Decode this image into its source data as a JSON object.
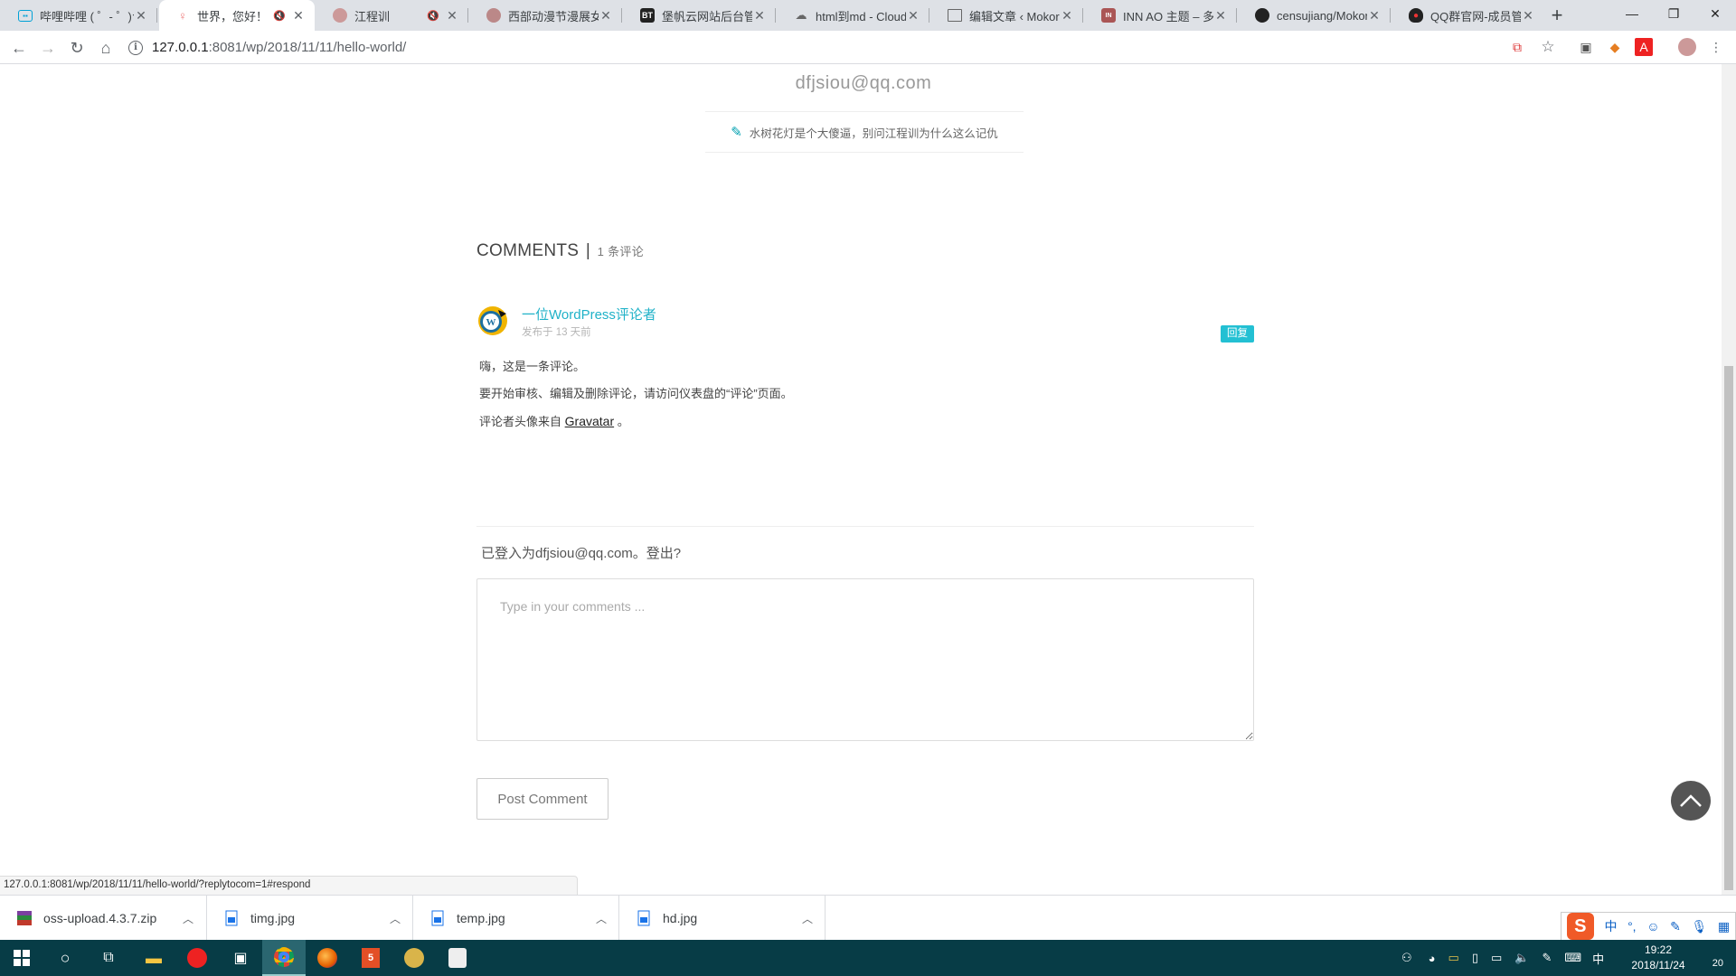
{
  "browser": {
    "tabs": [
      {
        "title": "哔哩哔哩 ( ゜- ゜)つロ 干杯~",
        "favicon": "bilibili-icon",
        "color": "#00a1d6"
      },
      {
        "title": "世界，您好！ - Mokore",
        "favicon": "anime-girl-icon",
        "color": "#e77",
        "muted": true
      },
      {
        "title": "江程训",
        "favicon": "avatar-icon",
        "color": "#a66",
        "muted": true
      },
      {
        "title": "西部动漫节漫展女装大佬",
        "favicon": "avatar-icon",
        "color": "#a66"
      },
      {
        "title": "堡帆云网站后台管理",
        "favicon": "bt-icon",
        "color": "#222",
        "badge": "BT"
      },
      {
        "title": "html到md - CloudConvert",
        "favicon": "cloud-icon",
        "color": "#666"
      },
      {
        "title": "编辑文章 ‹ Mokore",
        "favicon": "document-icon",
        "color": "#666"
      },
      {
        "title": "INN AO 主题 – 多功能",
        "favicon": "inn-icon",
        "color": "#a55"
      },
      {
        "title": "censujiang/Mokore",
        "favicon": "github-icon",
        "color": "#222"
      },
      {
        "title": "QQ群官网-成员管理",
        "favicon": "qq-icon",
        "color": "#e33"
      }
    ],
    "url_host": "127.0.0.1",
    "url_path": ":8081/wp/2018/11/11/hello-world/"
  },
  "author": {
    "email": "dfjsiou@qq.com",
    "bio": "水树花灯是个大傻逼，别问江程训为什么这么记仇"
  },
  "comments_section": {
    "heading": "COMMENTS",
    "count": "1 条评论",
    "items": [
      {
        "author": "一位WordPress评论者",
        "date": "发布于 13 天前",
        "reply_label": "回复",
        "lines": [
          "嗨，这是一条评论。",
          "要开始审核、编辑及删除评论，请访问仪表盘的“评论”页面。"
        ],
        "gravatar_prefix": "评论者头像来自",
        "gravatar_link": "Gravatar",
        "gravatar_suffix": "。"
      }
    ]
  },
  "form": {
    "logged_in_text": "已登入为dfjsiou@qq.com。登出?",
    "placeholder": "Type in your comments ...",
    "value": "",
    "submit_label": "Post Comment"
  },
  "status_url": "127.0.0.1:8081/wp/2018/11/11/hello-world/?replytocom=1#respond",
  "downloads": [
    {
      "name": "oss-upload.4.3.7.zip",
      "icon": "zip-icon"
    },
    {
      "name": "timg.jpg",
      "icon": "image-file-icon"
    },
    {
      "name": "temp.jpg",
      "icon": "image-file-icon"
    },
    {
      "name": "hd.jpg",
      "icon": "image-file-icon"
    }
  ],
  "ime": {
    "lang": "中",
    "punct": "°,"
  },
  "taskbar": {
    "time": "19:22",
    "date": "2018/11/24",
    "ime_lang": "中",
    "notifications": "20"
  },
  "colors": {
    "accent": "#23c0d3",
    "author_link": "#20b2c8",
    "taskbar": "#073c46",
    "tabbar": "#dee1e6"
  }
}
